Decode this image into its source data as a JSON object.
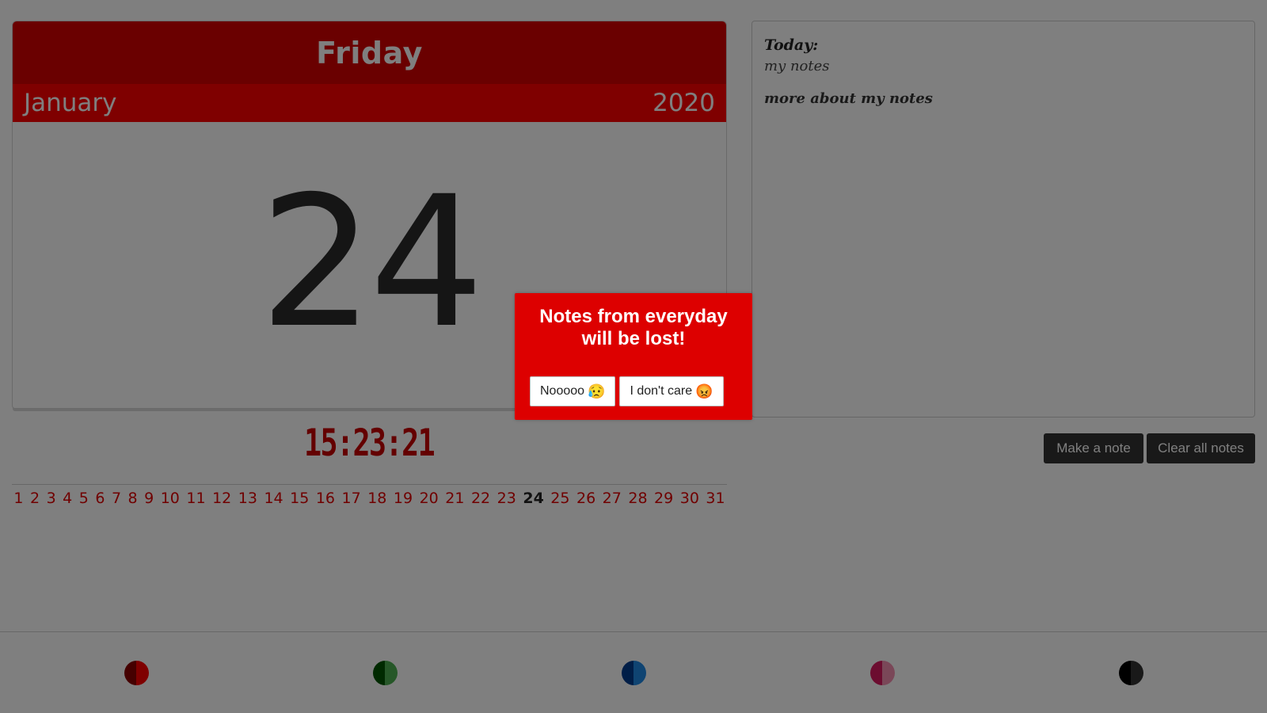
{
  "calendar": {
    "weekday": "Friday",
    "month": "January",
    "year": "2020",
    "day": "24",
    "colors": {
      "primary": "#d40000",
      "secondary": "#ff0000"
    }
  },
  "clock": {
    "time": "15:23:21"
  },
  "day_strip": {
    "days": [
      "1",
      "2",
      "3",
      "4",
      "5",
      "6",
      "7",
      "8",
      "9",
      "10",
      "11",
      "12",
      "13",
      "14",
      "15",
      "16",
      "17",
      "18",
      "19",
      "20",
      "21",
      "22",
      "23",
      "24",
      "25",
      "26",
      "27",
      "28",
      "29",
      "30",
      "31"
    ],
    "active_day": "24"
  },
  "notes": {
    "heading": "Today:",
    "subtitle": "my notes",
    "body": "more about my notes"
  },
  "actions": {
    "make_note": "Make a note",
    "clear_notes": "Clear all notes"
  },
  "palette": [
    {
      "name": "red",
      "c1": "#8b0000",
      "c2": "#ff0000"
    },
    {
      "name": "green",
      "c1": "#005500",
      "c2": "#4caf50"
    },
    {
      "name": "blue",
      "c1": "#003c8f",
      "c2": "#1e88e5"
    },
    {
      "name": "pink",
      "c1": "#d81b60",
      "c2": "#f48fb1"
    },
    {
      "name": "black",
      "c1": "#000000",
      "c2": "#333333"
    }
  ],
  "modal": {
    "title": "Notes from everyday will be lost!",
    "cancel_label": "Nooooo",
    "cancel_emoji": "😥",
    "confirm_label": "I don't care",
    "confirm_emoji": "😡"
  }
}
